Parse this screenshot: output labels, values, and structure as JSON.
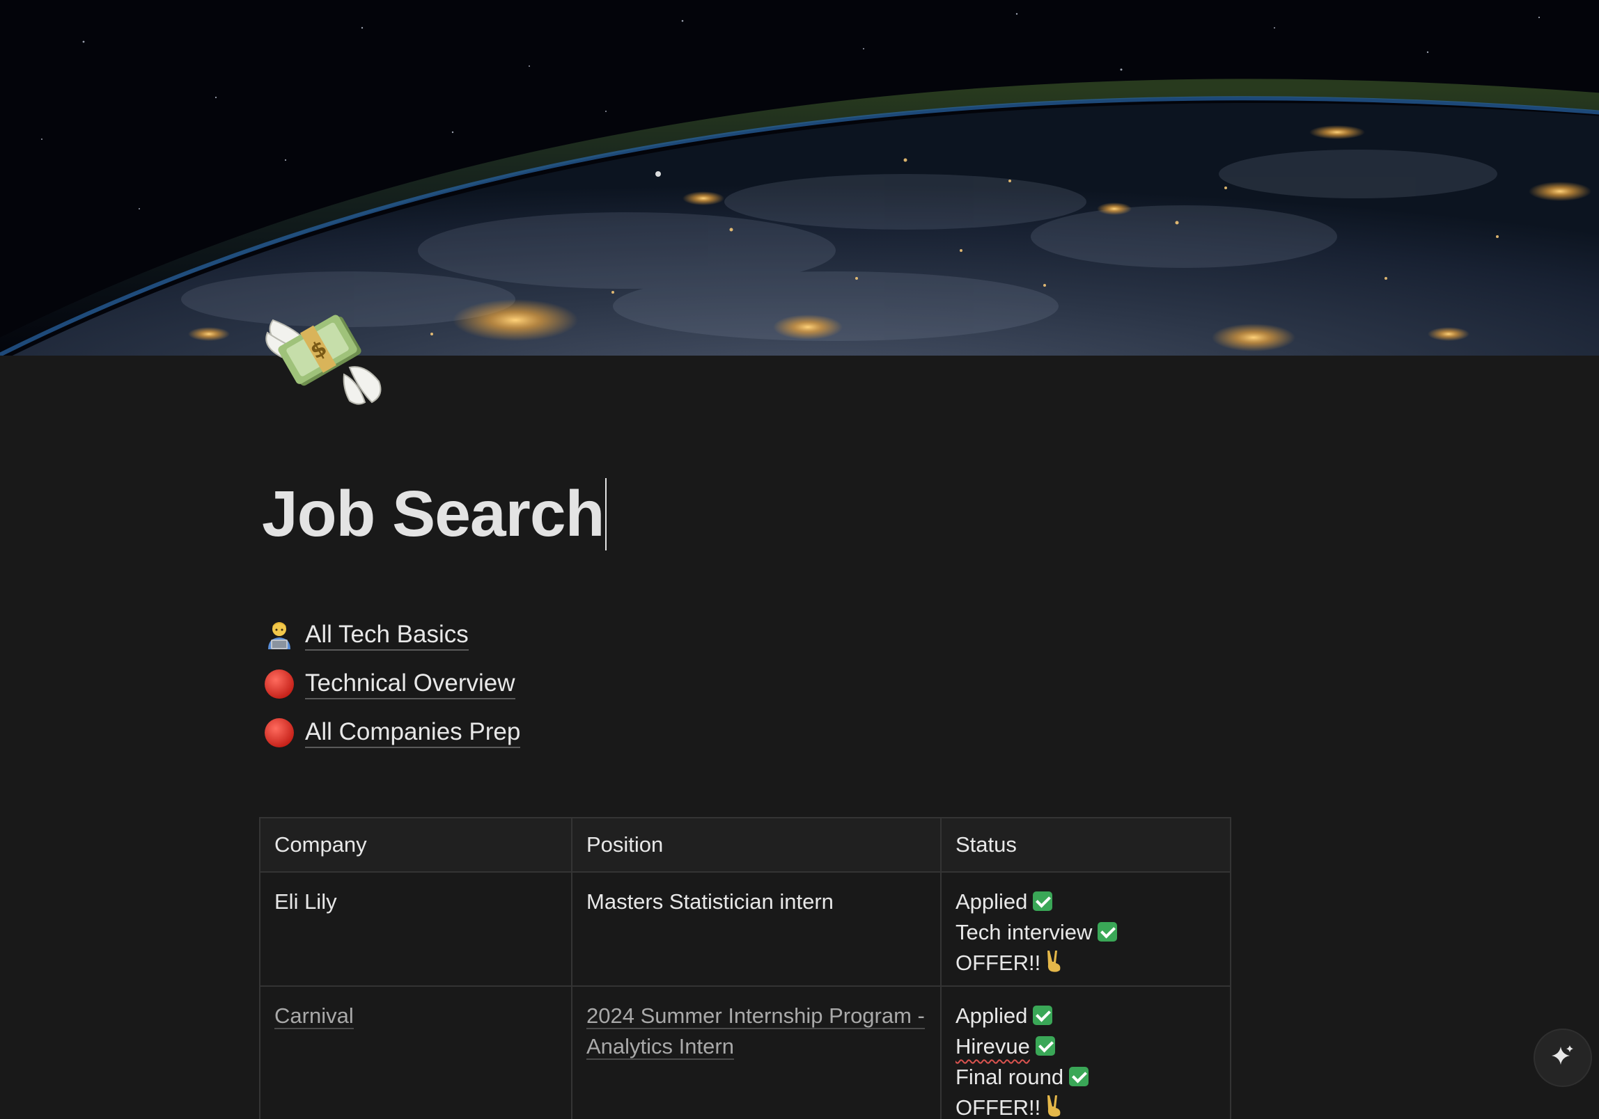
{
  "page": {
    "title": "Job Search",
    "icon": "money-with-wings-icon"
  },
  "links": [
    {
      "icon": "technologist-icon",
      "label": "All Tech Basics"
    },
    {
      "icon": "red-circle-icon",
      "label": "Technical Overview"
    },
    {
      "icon": "red-circle-icon",
      "label": "All Companies Prep"
    }
  ],
  "table": {
    "headers": [
      "Company",
      "Position",
      "Status"
    ],
    "rows": [
      {
        "company": "Eli Lily",
        "position": "Masters Statistician intern",
        "status": [
          "Applied",
          "Tech interview",
          "OFFER!!"
        ]
      },
      {
        "company": "Carnival",
        "position": "2024 Summer Internship Program - Analytics Intern",
        "status": [
          "Applied",
          "Hirevue",
          "Final round",
          "OFFER!!"
        ]
      }
    ]
  },
  "colors": {
    "background": "#191919",
    "text": "#e6e6e6",
    "check": "#3aa757",
    "red_circle": "#d9342b"
  }
}
